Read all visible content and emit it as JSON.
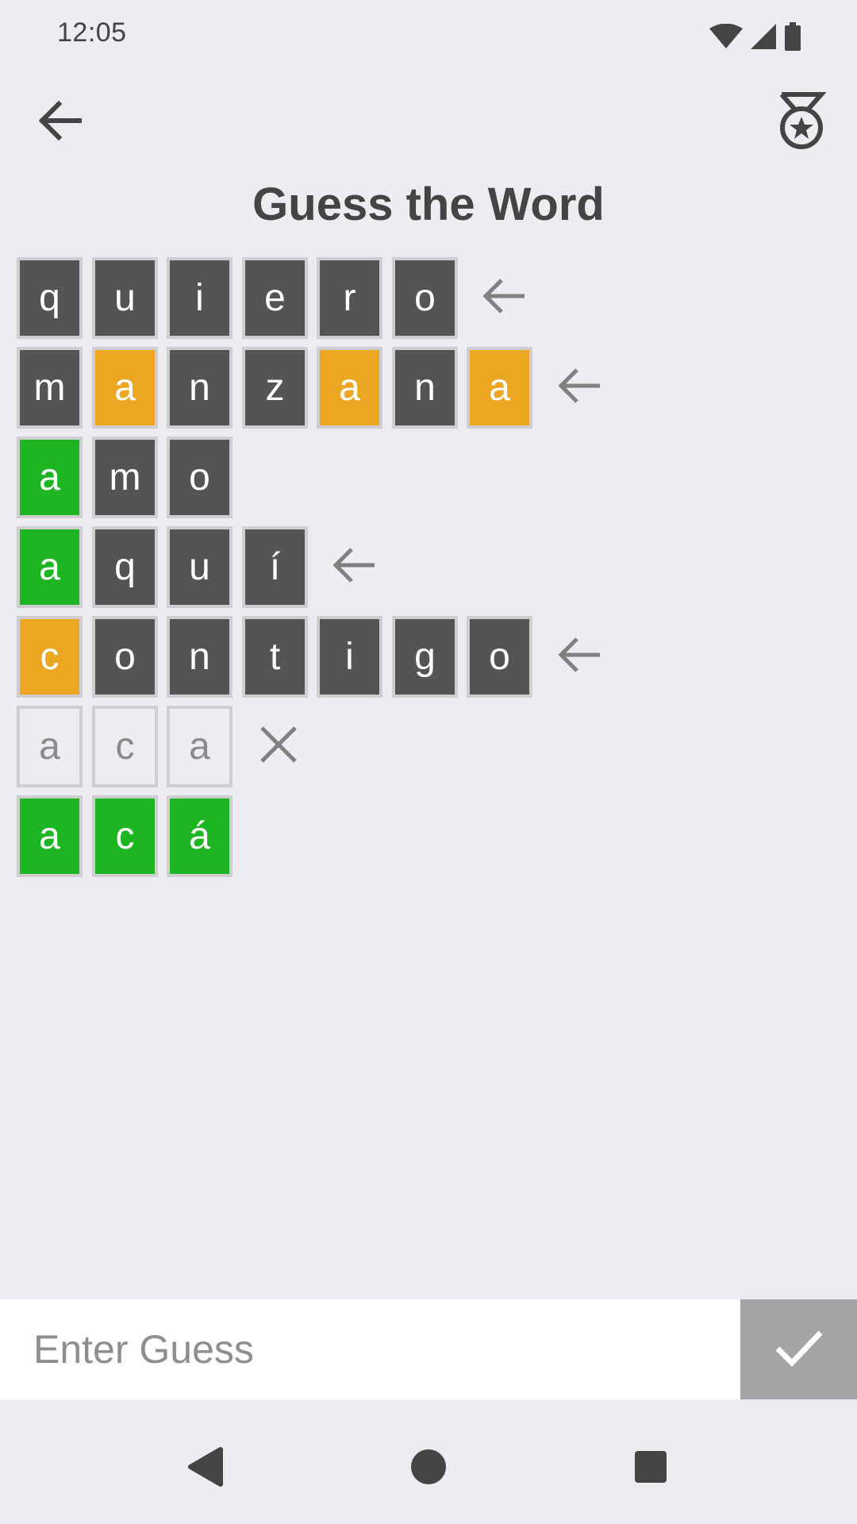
{
  "status_bar": {
    "time": "12:05",
    "icons": [
      "wifi-icon",
      "cell-signal-icon",
      "battery-icon"
    ]
  },
  "header": {
    "back_icon": "arrow-back-icon",
    "achievements_icon": "medal-icon",
    "title": "Guess the Word"
  },
  "colors": {
    "absent": "#545454",
    "present": "#eba622",
    "correct": "#1db622",
    "pending": "#ececf1"
  },
  "board": {
    "rows": [
      {
        "letters": [
          "q",
          "u",
          "i",
          "e",
          "r",
          "o"
        ],
        "states": [
          "absent",
          "absent",
          "absent",
          "absent",
          "absent",
          "absent"
        ],
        "mark": "arrow-left-icon"
      },
      {
        "letters": [
          "m",
          "a",
          "n",
          "z",
          "a",
          "n",
          "a"
        ],
        "states": [
          "absent",
          "present",
          "absent",
          "absent",
          "present",
          "absent",
          "present"
        ],
        "mark": "arrow-left-icon"
      },
      {
        "letters": [
          "a",
          "m",
          "o"
        ],
        "states": [
          "correct",
          "absent",
          "absent"
        ],
        "mark": ""
      },
      {
        "letters": [
          "a",
          "q",
          "u",
          "í"
        ],
        "states": [
          "correct",
          "absent",
          "absent",
          "absent"
        ],
        "mark": "arrow-left-icon"
      },
      {
        "letters": [
          "c",
          "o",
          "n",
          "t",
          "i",
          "g",
          "o"
        ],
        "states": [
          "present",
          "absent",
          "absent",
          "absent",
          "absent",
          "absent",
          "absent"
        ],
        "mark": "arrow-left-icon"
      },
      {
        "letters": [
          "a",
          "c",
          "a"
        ],
        "states": [
          "pending",
          "pending",
          "pending"
        ],
        "mark": "close-icon"
      },
      {
        "letters": [
          "a",
          "c",
          "á"
        ],
        "states": [
          "correct",
          "correct",
          "correct"
        ],
        "mark": ""
      }
    ]
  },
  "guess": {
    "placeholder": "Enter Guess",
    "value": "",
    "submit_icon": "check-icon"
  },
  "nav": {
    "icons": [
      "nav-back-icon",
      "nav-home-icon",
      "nav-recents-icon"
    ]
  }
}
